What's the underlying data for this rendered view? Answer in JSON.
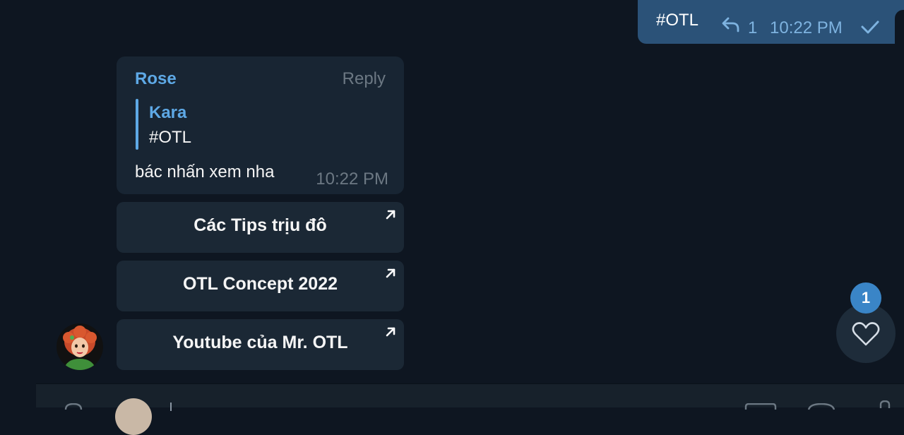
{
  "outgoing": {
    "text": "#OTL",
    "reply_count": "1",
    "time": "10:22 PM",
    "status_icon": "check-icon"
  },
  "message": {
    "sender": "Rose",
    "reply_label": "Reply",
    "quote": {
      "author": "Kara",
      "text": "#OTL"
    },
    "text": "bác nhấn xem nha",
    "time": "10:22 PM"
  },
  "buttons": [
    {
      "label": "Các Tips trịu đô",
      "icon": "external-link-arrow-icon"
    },
    {
      "label": "OTL Concept 2022",
      "icon": "external-link-arrow-icon"
    },
    {
      "label": "Youtube của Mr. OTL",
      "icon": "external-link-arrow-icon"
    }
  ],
  "reaction": {
    "badge_count": "1",
    "icon": "heart-icon"
  },
  "colors": {
    "background": "#0e1621",
    "outgoing_bubble": "#2b5278",
    "incoming_bubble": "#182533",
    "accent": "#5ea9e6",
    "badge": "#3a85c7"
  }
}
